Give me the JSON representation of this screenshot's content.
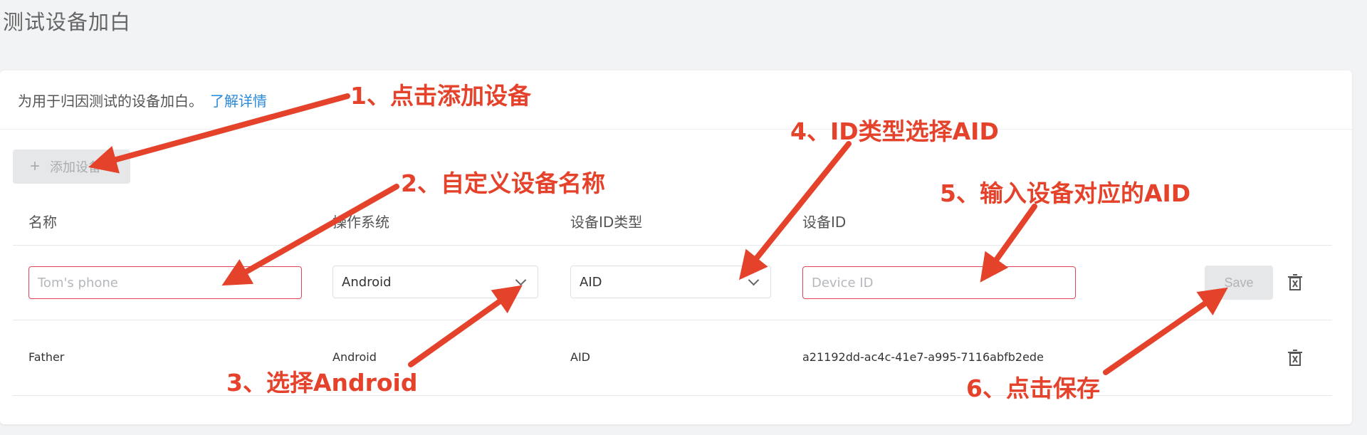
{
  "page": {
    "title": "测试设备加白"
  },
  "intro": {
    "text": "为用于归因测试的设备加白。",
    "link": "了解详情"
  },
  "toolbar": {
    "add_label": "添加设备"
  },
  "table": {
    "headers": [
      "名称",
      "操作系统",
      "设备ID类型",
      "设备ID"
    ],
    "new_row": {
      "name_placeholder": "Tom's phone",
      "os_value": "Android",
      "id_type_value": "AID",
      "device_id_placeholder": "Device ID",
      "save_label": "Save"
    },
    "rows": [
      {
        "name": "Father",
        "os": "Android",
        "id_type": "AID",
        "device_id": "a21192dd-ac4c-41e7-a995-7116abfb2ede"
      }
    ]
  },
  "annotations": [
    "1、点击添加设备",
    "2、自定义设备名称",
    "3、选择Android",
    "4、ID类型选择AID",
    "5、输入设备对应的AID",
    "6、点击保存"
  ],
  "colors": {
    "annotation": "#e5422b",
    "link": "#2a8ad9",
    "input_border": "#e0455a"
  }
}
